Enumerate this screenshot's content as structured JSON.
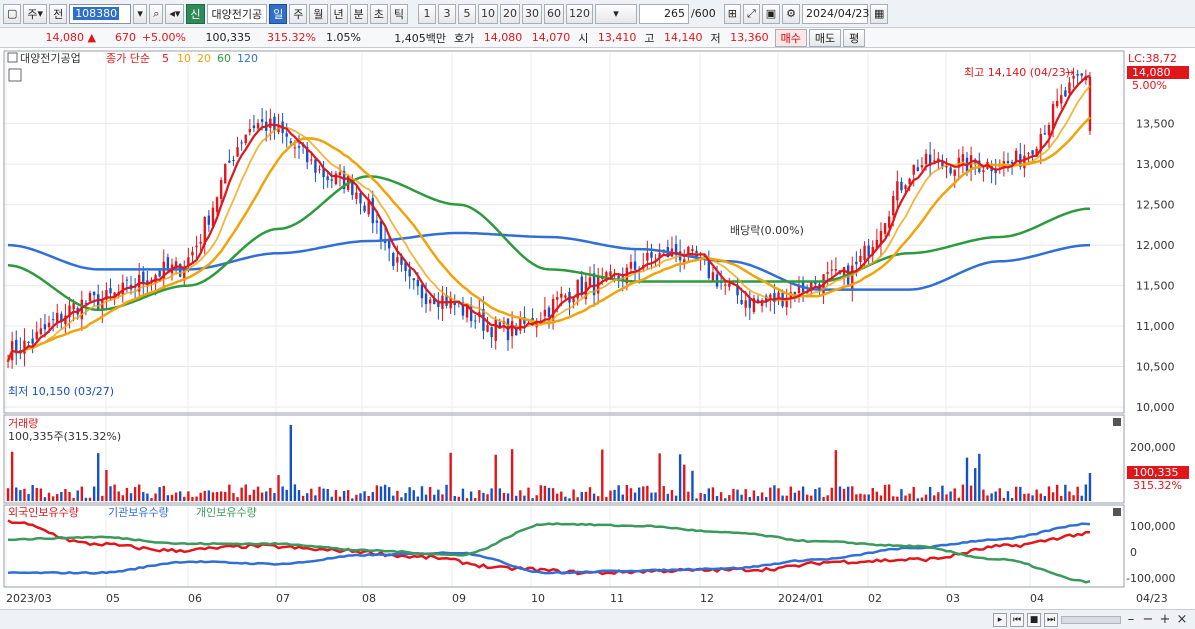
{
  "toolbar": {
    "type_label": "주",
    "scope_label": "전",
    "code": "108380",
    "badge_new": "신",
    "stock_name": "대양전기공",
    "periods": [
      "일",
      "주",
      "월",
      "년",
      "분",
      "초",
      "틱"
    ],
    "selected_period": "일",
    "intervals": [
      "1",
      "3",
      "5",
      "10",
      "20",
      "30",
      "60",
      "120"
    ],
    "count": "265",
    "count_total": "/600",
    "date": "2024/04/23"
  },
  "quote": {
    "price": "14,080",
    "change_arrow": "▲",
    "change": "670",
    "change_pct": "+5.00%",
    "volume": "100,335",
    "volume_ratio": "315.32%",
    "turnover_pct": "1.05%",
    "amount": "1,405백만",
    "bid_label": "호가",
    "ask_price": "14,080",
    "bid_price": "14,070",
    "open_label": "시",
    "open": "13,410",
    "high_label": "고",
    "high": "14,140",
    "low_label": "저",
    "low": "13,360",
    "buy_label": "매수",
    "sell_label": "매도",
    "flat_label": "평"
  },
  "colors": {
    "up": "#e0161b",
    "down": "#1450c8",
    "ma5": "#e0161b",
    "ma10": "#f0a30a",
    "ma20": "#f0a30a",
    "ma60": "#2e9a3e",
    "ma120": "#2f6fd6",
    "foreign": "#e0161b",
    "institution": "#2f6fd6",
    "individual": "#3a9a5c"
  },
  "price_panel": {
    "title": "대양전기공업",
    "ma_label": "종가 단순",
    "ma_periods": [
      "5",
      "10",
      "20",
      "60",
      "120"
    ],
    "high_annotation": "최고 14,140 (04/23)",
    "low_annotation": "최저 10,150 (03/27)",
    "dividend_annotation": "배당락(0.00%)",
    "lc_label": "LC:38,72",
    "last_price_tag": "14,080",
    "last_pct": "5.00%",
    "y_ticks": [
      "13,500",
      "13,000",
      "12,500",
      "12,000",
      "11,500",
      "11,000",
      "10,500",
      "10,000"
    ]
  },
  "volume_panel": {
    "title": "거래량",
    "value_label": "100,335주(315.32%)",
    "y_tick": "200,000",
    "last_tag": "100,335",
    "last_pct": "315.32%"
  },
  "holdings_panel": {
    "series_labels": [
      "외국인보유수량",
      "기관보유수량",
      "개인보유수량"
    ],
    "y_ticks": [
      "100,000",
      "0",
      "-100,000"
    ]
  },
  "x_axis": {
    "labels": [
      "2023/03",
      "05",
      "06",
      "07",
      "08",
      "09",
      "10",
      "11",
      "12",
      "2024/01",
      "02",
      "03",
      "04"
    ],
    "last_label": "04/23"
  },
  "chart_data": {
    "type": "candlestick",
    "price_ylim": [
      10000,
      14200
    ],
    "price_anchors": [
      {
        "x": "2023/03",
        "close": 10700
      },
      {
        "x": "05",
        "close": 11300
      },
      {
        "x": "06",
        "close": 11700
      },
      {
        "x": "07",
        "close": 13500
      },
      {
        "x": "08",
        "close": 12800
      },
      {
        "x": "09",
        "close": 11400
      },
      {
        "x": "10",
        "close": 10950
      },
      {
        "x": "11",
        "close": 11500
      },
      {
        "x": "12",
        "close": 11900
      },
      {
        "x": "2024/01",
        "close": 11300
      },
      {
        "x": "02",
        "close": 11600
      },
      {
        "x": "03",
        "close": 13000
      },
      {
        "x": "04",
        "close": 13000
      },
      {
        "x": "04/23",
        "close": 14080
      }
    ],
    "ma60_anchors": [
      11750,
      11200,
      11500,
      12200,
      12850,
      12500,
      11700,
      11550,
      11550,
      11550,
      11900,
      12100,
      12450
    ],
    "ma120_anchors": [
      12000,
      11700,
      11700,
      11900,
      12050,
      12150,
      12100,
      11950,
      11800,
      11450,
      11450,
      11800,
      12000
    ],
    "holdings_ylim": [
      -150000,
      150000
    ],
    "foreign_anchors": [
      130000,
      30000,
      0,
      20000,
      0,
      -30000,
      -80000,
      -100000,
      -90000,
      -85000,
      -50000,
      -40000,
      20000,
      75000
    ],
    "institution_anchors": [
      -100000,
      -100000,
      -50000,
      -60000,
      -20000,
      -10000,
      -100000,
      -90000,
      -80000,
      -40000,
      10000,
      50000,
      120000
    ],
    "individual_anchors": [
      50000,
      60000,
      30000,
      30000,
      0,
      -20000,
      120000,
      110000,
      80000,
      40000,
      20000,
      -40000,
      -140000
    ]
  }
}
